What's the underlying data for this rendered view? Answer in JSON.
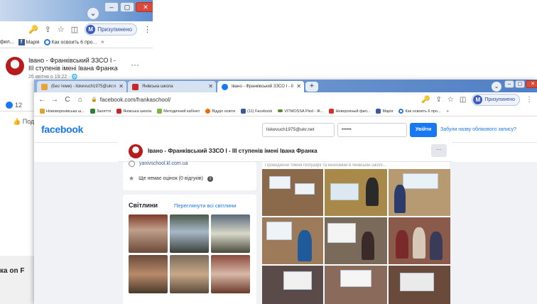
{
  "back_window": {
    "chevron": "⌄",
    "win_buttons": [
      "–",
      "▢",
      "✕"
    ],
    "toolbar_icons": [
      "key-icon",
      "share-icon",
      "star-icon",
      "sidebar-icon",
      "more-icon"
    ],
    "toolbar_symbols": [
      "🔑",
      "⇪",
      "☆",
      "◫",
      "⋮"
    ],
    "profile_initial": "M",
    "profile_label": "Призупинено",
    "bookmarks": [
      {
        "label": "фил...",
        "icon": ""
      },
      {
        "label": "Марія",
        "icon": "f"
      },
      {
        "label": "Как освоить 6 про...",
        "icon": "o"
      },
      {
        "label": "»",
        "icon": ""
      }
    ],
    "post": {
      "title": "Івано - Франківський ЗЗСО І - ІІІ ступенів імені Івана Франка",
      "date": "26 квітня о 19:22 · 🌐",
      "more": "···",
      "likes": "12",
      "like_button": "Под"
    },
    "bottom_text": "ка on F"
  },
  "browser": {
    "tabs": [
      {
        "label": "(Без теми) - liskevuch1975@ukr.n",
        "color": "#e8a33a",
        "active": false
      },
      {
        "label": "Янівська школа",
        "color": "#c62828",
        "active": false
      },
      {
        "label": "Івано - Франківський ЗЗСО І - ІІ",
        "color": "#1877f2",
        "active": true
      }
    ],
    "tab_close": "✕",
    "newtab": "+",
    "chevron": "⌄",
    "win_buttons": [
      "–",
      "▢",
      "✕"
    ],
    "nav": {
      "back": "←",
      "forward": "→",
      "reload": "C",
      "home": "⌂",
      "lock": "🔒",
      "url": "facebook.com/frankaschool/"
    },
    "toolbar_symbols": [
      "🔑",
      "⇪",
      "☆",
      "◫",
      "⋮"
    ],
    "profile_initial": "M",
    "profile_label": "Призупинено",
    "bookmarks": [
      {
        "label": "Нововоронівська ш...",
        "color": "#e0a030"
      },
      {
        "label": "Заняття",
        "color": "#2e7d32"
      },
      {
        "label": "Янівська школа",
        "color": "#c62828"
      },
      {
        "label": "Методичний кабінет",
        "color": "#7cb342"
      },
      {
        "label": "Відділ освіти",
        "color": "#ef6c00"
      },
      {
        "label": "(11) Facebook",
        "color": "#3b5998"
      },
      {
        "label": "VITMOSSA Pled - Ж...",
        "color": "#558b2f"
      },
      {
        "label": "Неверояный фил...",
        "color": "#d32f2f"
      },
      {
        "label": "Марія",
        "color": "#3b5998"
      },
      {
        "label": "Как освоить 6 про...",
        "color": "#2b77d6"
      },
      {
        "label": "»",
        "color": ""
      }
    ]
  },
  "facebook": {
    "logo": "facebook",
    "email_value": "liskevuch1975@ukr.net",
    "password_value": "••••••",
    "login_button": "Увійти",
    "forgot_link": "Забули назву облікового запису?",
    "page_name": "Івано - Франківський ЗЗСО І - ІІІ ступенів імені Івана Франка",
    "page_more": "···",
    "website": "yanivschool.kl.com.ua",
    "rating": "Ще немає оцінок (0 відгуків)",
    "photos_title": "Світлини",
    "photos_link": "Переглянути всі світлини",
    "post_caption": "Проведення тижня географії та економіки в Янівській школі..."
  },
  "colors": {
    "facebook_blue": "#1877f2",
    "page_bg": "#f0f2f5"
  }
}
